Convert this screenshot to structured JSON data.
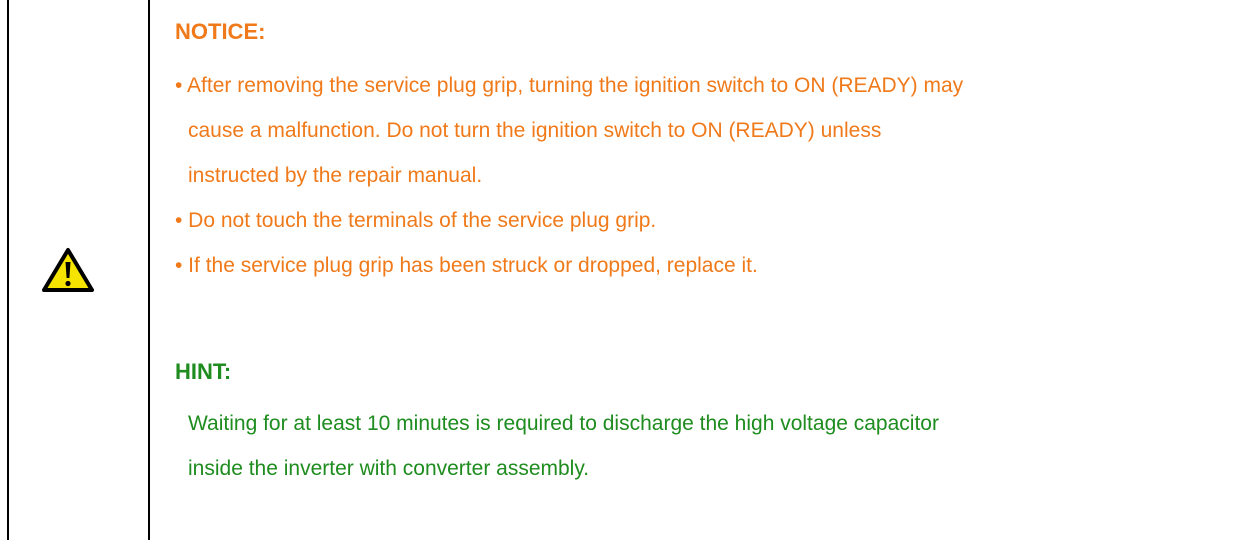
{
  "colors": {
    "notice": "#f07a1a",
    "hint": "#1e8c1e",
    "border": "#000000",
    "icon_fill": "#f5e400"
  },
  "icon": "warning-triangle-icon",
  "notice": {
    "heading": "NOTICE:",
    "lines": [
      "• After removing the service plug grip, turning the ignition switch to ON (READY) may",
      "cause a malfunction. Do not turn the ignition switch to ON (READY) unless",
      "instructed by the repair manual.",
      "• Do not touch the terminals of the service plug grip.",
      "• If the service plug grip has been struck or dropped, replace it."
    ]
  },
  "hint": {
    "heading": "HINT:",
    "lines": [
      "Waiting for at least 10 minutes is required to discharge the high voltage capacitor",
      "inside the inverter with converter assembly."
    ]
  }
}
